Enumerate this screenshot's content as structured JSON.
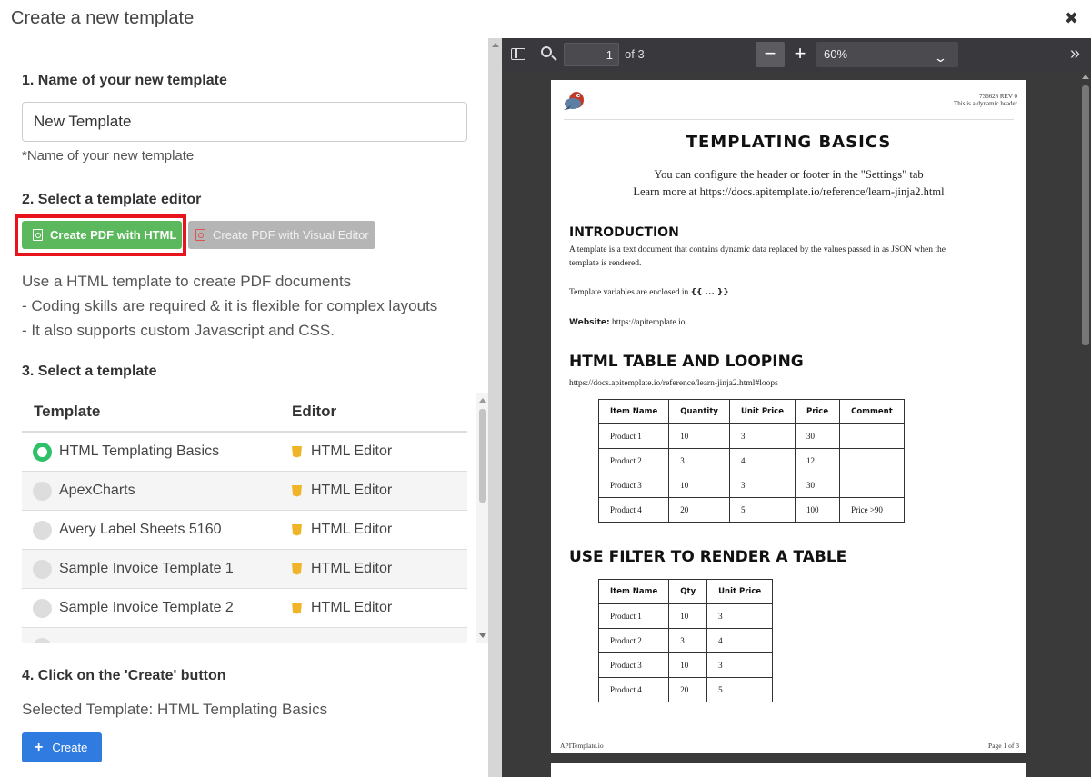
{
  "modal": {
    "title": "Create a new template",
    "close": "✖"
  },
  "step1": {
    "heading": "1. Name of your new template",
    "name_value": "New Template",
    "hint": "*Name of your new template"
  },
  "step2": {
    "heading": "2. Select a template editor",
    "btn_html": "Create PDF with HTML",
    "btn_visual": "Create PDF with Visual Editor",
    "desc": [
      "Use a HTML template to create PDF documents",
      "- Coding skills are required & it is flexible for complex layouts",
      "- It also supports custom Javascript and CSS."
    ]
  },
  "step3": {
    "heading": "3. Select a template",
    "columns": [
      "Template",
      "Editor"
    ],
    "rows": [
      {
        "name": "HTML Templating Basics",
        "editor": "HTML Editor",
        "selected": true
      },
      {
        "name": "ApexCharts",
        "editor": "HTML Editor",
        "selected": false
      },
      {
        "name": "Avery Label Sheets 5160",
        "editor": "HTML Editor",
        "selected": false
      },
      {
        "name": "Sample Invoice Template 1",
        "editor": "HTML Editor",
        "selected": false
      },
      {
        "name": "Sample Invoice Template 2",
        "editor": "HTML Editor",
        "selected": false
      }
    ]
  },
  "step4": {
    "heading": "4. Click on the 'Create' button",
    "selected_label": "Selected Template: HTML Templating Basics",
    "create_btn": "Create"
  },
  "viewer": {
    "page_number": "1",
    "page_of": "of 3",
    "zoom": "60%",
    "page": {
      "header_id": "736628 REV 0",
      "header_sub": "This is a dynamic header",
      "title": "TEMPLATING BASICS",
      "lead1": "You can configure the header or footer in the \"Settings\" tab",
      "lead2": "Learn more at https://docs.apitemplate.io/reference/learn-jinja2.html",
      "intro_heading": "INTRODUCTION",
      "intro_text": "A template is a text document that contains dynamic data replaced by the values passed in as JSON when the template is rendered.",
      "vars_text": "Template variables are enclosed in",
      "vars_code": "{{ ... }}",
      "website_label": "Website:",
      "website_value": "https://apitemplate.io",
      "loop_heading": "HTML TABLE AND LOOPING",
      "loop_link": "https://docs.apitemplate.io/reference/learn-jinja2.html#loops",
      "table1": {
        "headers": [
          "Item Name",
          "Quantity",
          "Unit Price",
          "Price",
          "Comment"
        ],
        "rows": [
          [
            "Product 1",
            "10",
            "3",
            "30",
            ""
          ],
          [
            "Product 2",
            "3",
            "4",
            "12",
            ""
          ],
          [
            "Product 3",
            "10",
            "3",
            "30",
            ""
          ],
          [
            "Product 4",
            "20",
            "5",
            "100",
            "Price >90"
          ]
        ]
      },
      "filter_heading": "USE FILTER TO RENDER A TABLE",
      "table2": {
        "headers": [
          "Item Name",
          "Qty",
          "Unit Price"
        ],
        "rows": [
          [
            "Product 1",
            "10",
            "3"
          ],
          [
            "Product 2",
            "3",
            "4"
          ],
          [
            "Product 3",
            "10",
            "3"
          ],
          [
            "Product 4",
            "20",
            "5"
          ]
        ]
      },
      "footer_left": "APITemplate.io",
      "footer_right": "Page 1 of 3"
    }
  }
}
